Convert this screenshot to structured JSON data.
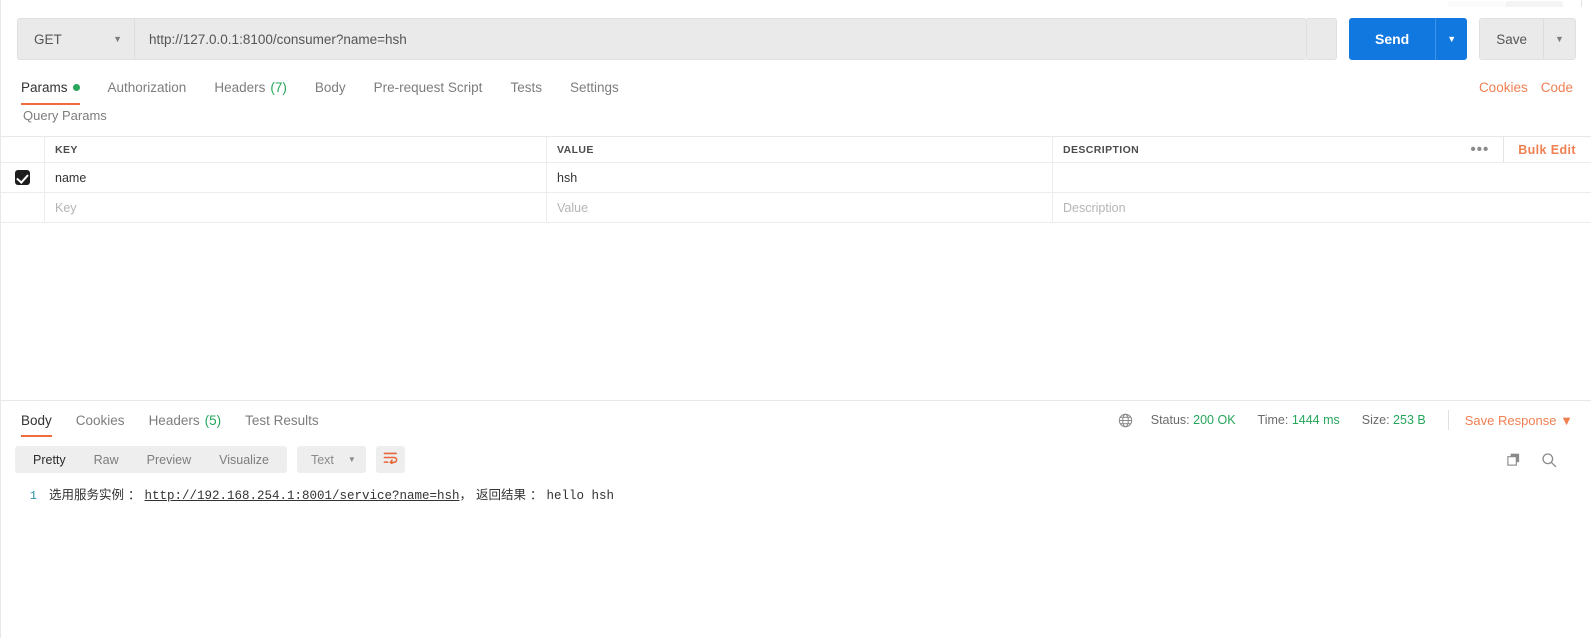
{
  "request": {
    "method": "GET",
    "url": "http://127.0.0.1:8100/consumer?name=hsh",
    "send_label": "Send",
    "save_label": "Save",
    "tabs": [
      {
        "label": "Params",
        "badge": "",
        "dot": true,
        "active": true
      },
      {
        "label": "Authorization",
        "badge": "",
        "dot": false,
        "active": false
      },
      {
        "label": "Headers",
        "badge": "(7)",
        "dot": false,
        "active": false
      },
      {
        "label": "Body",
        "badge": "",
        "dot": false,
        "active": false
      },
      {
        "label": "Pre-request Script",
        "badge": "",
        "dot": false,
        "active": false
      },
      {
        "label": "Tests",
        "badge": "",
        "dot": false,
        "active": false
      },
      {
        "label": "Settings",
        "badge": "",
        "dot": false,
        "active": false
      }
    ],
    "cookies_link": "Cookies",
    "code_link": "Code"
  },
  "query_params": {
    "section_label": "Query Params",
    "columns": [
      "KEY",
      "VALUE",
      "DESCRIPTION"
    ],
    "bulk_edit_label": "Bulk Edit",
    "more_icon": "•••",
    "rows": [
      {
        "checked": true,
        "key": "name",
        "value": "hsh",
        "description": ""
      }
    ],
    "new_row_placeholders": {
      "key": "Key",
      "value": "Value",
      "description": "Description"
    }
  },
  "response": {
    "tabs": [
      {
        "label": "Body",
        "badge": "",
        "active": true
      },
      {
        "label": "Cookies",
        "badge": "",
        "active": false
      },
      {
        "label": "Headers",
        "badge": "(5)",
        "active": false
      },
      {
        "label": "Test Results",
        "badge": "",
        "active": false
      }
    ],
    "status": {
      "status_label": "Status:",
      "status_value": "200 OK",
      "time_label": "Time:",
      "time_value": "1444 ms",
      "size_label": "Size:",
      "size_value": "253 B"
    },
    "save_response_label": "Save Response",
    "view_modes": [
      {
        "label": "Pretty",
        "active": true
      },
      {
        "label": "Raw",
        "active": false
      },
      {
        "label": "Preview",
        "active": false
      },
      {
        "label": "Visualize",
        "active": false
      }
    ],
    "format_selected": "Text",
    "body": {
      "line_number": "1",
      "prefix": "选用服务实例 ： ",
      "link": "http://192.168.254.1:8001/service?name=hsh",
      "suffix": "， 返回结果 ： ",
      "result": "hello hsh"
    }
  },
  "colors": {
    "accent_orange": "#f07f52",
    "tab_underline": "#ef6c3b",
    "send_blue": "#1178e0",
    "status_green": "#26a65b",
    "line_number_teal": "#2b91af"
  }
}
